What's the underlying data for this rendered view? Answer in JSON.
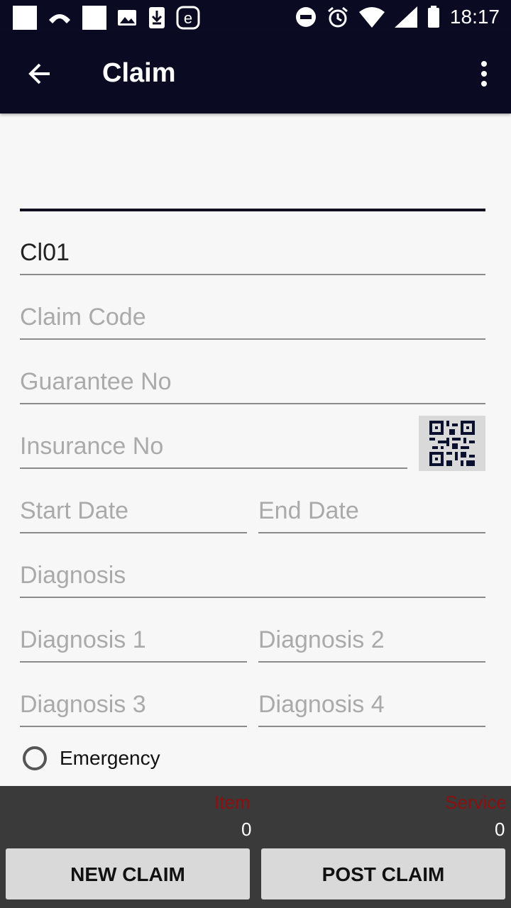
{
  "status_bar": {
    "time": "18:17"
  },
  "app_bar": {
    "title": "Claim"
  },
  "form": {
    "field_top_value": "",
    "cl_value": "Cl01",
    "claim_code_placeholder": "Claim Code",
    "guarantee_no_placeholder": "Guarantee No",
    "insurance_no_placeholder": "Insurance No",
    "start_date_placeholder": "Start Date",
    "end_date_placeholder": "End Date",
    "diagnosis_placeholder": "Diagnosis",
    "diagnosis1_placeholder": "Diagnosis 1",
    "diagnosis2_placeholder": "Diagnosis 2",
    "diagnosis3_placeholder": "Diagnosis 3",
    "diagnosis4_placeholder": "Diagnosis 4",
    "emergency_label": "Emergency"
  },
  "summary": {
    "item_label": "Item",
    "item_count": "0",
    "service_label": "Service",
    "service_count": "0"
  },
  "buttons": {
    "new_claim": "NEW CLAIM",
    "post_claim": "POST CLAIM"
  },
  "icons": {
    "back": "arrow-back-icon",
    "menu": "more-vert-icon",
    "qr": "qr-code-icon"
  }
}
